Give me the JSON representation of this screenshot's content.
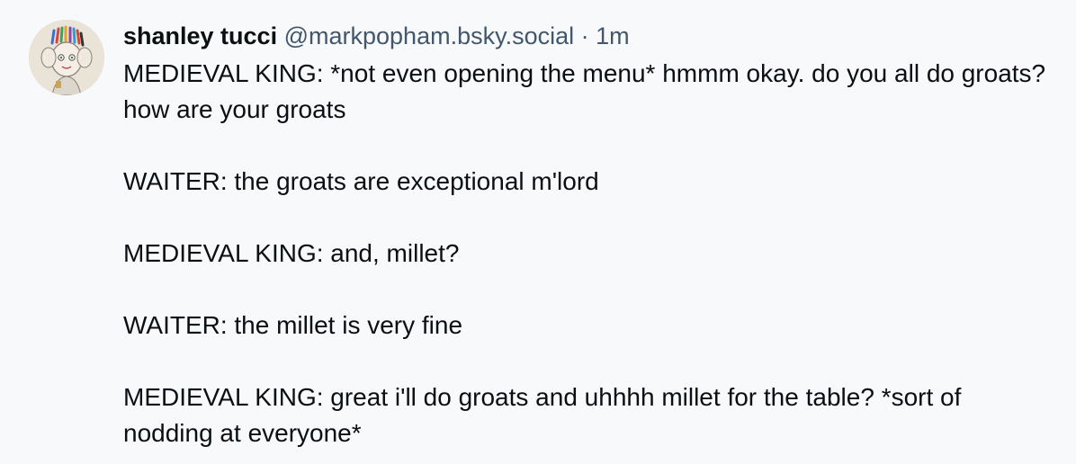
{
  "post": {
    "author": {
      "display_name": "shanley tucci",
      "handle": "@markpopham.bsky.social",
      "separator": "·",
      "time": "1m",
      "avatar_icon": "avatar-illustration"
    },
    "paragraphs": [
      "MEDIEVAL KING: *not even opening the menu* hmmm okay. do you all do groats? how are your groats",
      "WAITER: the groats are exceptional m'lord",
      "MEDIEVAL KING: and, millet?",
      "WAITER: the millet is very fine",
      "MEDIEVAL KING: great i'll do groats and uhhhh millet for the table? *sort of nodding at everyone*"
    ]
  },
  "colors": {
    "background": "#F8F9FA",
    "text": "#0B0F14",
    "muted": "#42576C"
  }
}
